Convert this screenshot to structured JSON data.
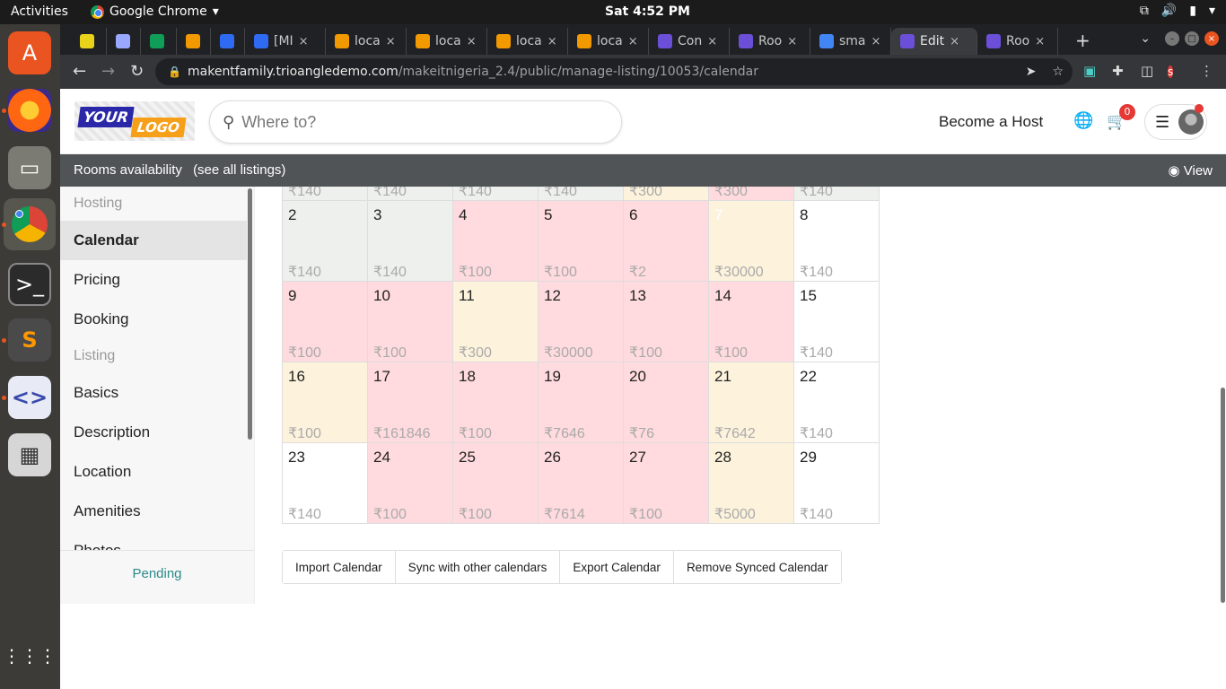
{
  "os": {
    "activities": "Activities",
    "app_name": "Google Chrome",
    "clock": "Sat  4:52 PM"
  },
  "tabs": [
    {
      "label": "",
      "favicon_color": "#e8d31a"
    },
    {
      "label": "",
      "favicon_color": "#9aa7ff"
    },
    {
      "label": "",
      "favicon_color": "#0f9d58"
    },
    {
      "label": "",
      "favicon_color": "#f29900"
    },
    {
      "label": "",
      "favicon_color": "#2e6bf2"
    },
    {
      "label": "[MI",
      "favicon_color": "#2e6bf2"
    },
    {
      "label": "loca",
      "favicon_color": "#f29900"
    },
    {
      "label": "loca",
      "favicon_color": "#f29900"
    },
    {
      "label": "loca",
      "favicon_color": "#f29900"
    },
    {
      "label": "loca",
      "favicon_color": "#f29900"
    },
    {
      "label": "Con",
      "favicon_color": "#6b4fd8"
    },
    {
      "label": "Roo",
      "favicon_color": "#6b4fd8"
    },
    {
      "label": "sma",
      "favicon_color": "#4285f4"
    },
    {
      "label": "Edit",
      "favicon_color": "#6b4fd8",
      "active": true
    },
    {
      "label": "Roo",
      "favicon_color": "#6b4fd8"
    }
  ],
  "address": {
    "host": "makentfamily.trioangledemo.com",
    "path": "/makeitnigeria_2.4/public/manage-listing/10053/calendar",
    "profile_initial": "s"
  },
  "site": {
    "logo_line1": "YOUR",
    "logo_line2": "LOGO",
    "search_placeholder": "Where to?",
    "become_host": "Become a Host",
    "cart_count": "0"
  },
  "subheader": {
    "title": "Rooms availability",
    "see_all": "(see all listings)",
    "view": "View"
  },
  "sidebar": {
    "hosting_heading": "Hosting",
    "listing_heading": "Listing",
    "hosting_items": [
      "Calendar",
      "Pricing",
      "Booking"
    ],
    "listing_items": [
      "Basics",
      "Description",
      "Location",
      "Amenities",
      "Photos"
    ],
    "active_item": "Calendar",
    "status": "Pending"
  },
  "calendar": {
    "top_row": [
      {
        "price": "₹140",
        "state": "past"
      },
      {
        "price": "₹140",
        "state": "past"
      },
      {
        "price": "₹140",
        "state": "past"
      },
      {
        "price": "₹140",
        "state": "past"
      },
      {
        "price": "₹300",
        "state": "booked"
      },
      {
        "price": "₹300",
        "state": "blocked"
      },
      {
        "price": "₹140",
        "state": "past"
      }
    ],
    "weeks": [
      [
        {
          "day": "2",
          "price": "₹140",
          "state": "past"
        },
        {
          "day": "3",
          "price": "₹140",
          "state": "past"
        },
        {
          "day": "4",
          "price": "₹100",
          "state": "blocked"
        },
        {
          "day": "5",
          "price": "₹100",
          "state": "blocked"
        },
        {
          "day": "6",
          "price": "₹2",
          "state": "blocked"
        },
        {
          "day": "7",
          "price": "₹30000",
          "state": "booked",
          "faded": true
        },
        {
          "day": "8",
          "price": "₹140",
          "state": "open"
        }
      ],
      [
        {
          "day": "9",
          "price": "₹100",
          "state": "blocked"
        },
        {
          "day": "10",
          "price": "₹100",
          "state": "blocked"
        },
        {
          "day": "11",
          "price": "₹300",
          "state": "booked"
        },
        {
          "day": "12",
          "price": "₹30000",
          "state": "blocked"
        },
        {
          "day": "13",
          "price": "₹100",
          "state": "blocked"
        },
        {
          "day": "14",
          "price": "₹100",
          "state": "blocked"
        },
        {
          "day": "15",
          "price": "₹140",
          "state": "open"
        }
      ],
      [
        {
          "day": "16",
          "price": "₹100",
          "state": "booked"
        },
        {
          "day": "17",
          "price": "₹161846",
          "state": "blocked"
        },
        {
          "day": "18",
          "price": "₹100",
          "state": "blocked"
        },
        {
          "day": "19",
          "price": "₹7646",
          "state": "blocked"
        },
        {
          "day": "20",
          "price": "₹76",
          "state": "blocked"
        },
        {
          "day": "21",
          "price": "₹7642",
          "state": "booked"
        },
        {
          "day": "22",
          "price": "₹140",
          "state": "open"
        }
      ],
      [
        {
          "day": "23",
          "price": "₹140",
          "state": "open"
        },
        {
          "day": "24",
          "price": "₹100",
          "state": "blocked"
        },
        {
          "day": "25",
          "price": "₹100",
          "state": "blocked"
        },
        {
          "day": "26",
          "price": "₹7614",
          "state": "blocked"
        },
        {
          "day": "27",
          "price": "₹100",
          "state": "blocked"
        },
        {
          "day": "28",
          "price": "₹5000",
          "state": "booked"
        },
        {
          "day": "29",
          "price": "₹140",
          "state": "open"
        }
      ]
    ],
    "buttons": [
      "Import Calendar",
      "Sync with other calendars",
      "Export Calendar",
      "Remove Synced Calendar"
    ]
  },
  "colors": {
    "blocked": "#ffdade",
    "booked": "#fdf3dc",
    "past": "#eef0ee",
    "accent": "#2a8a8a"
  }
}
